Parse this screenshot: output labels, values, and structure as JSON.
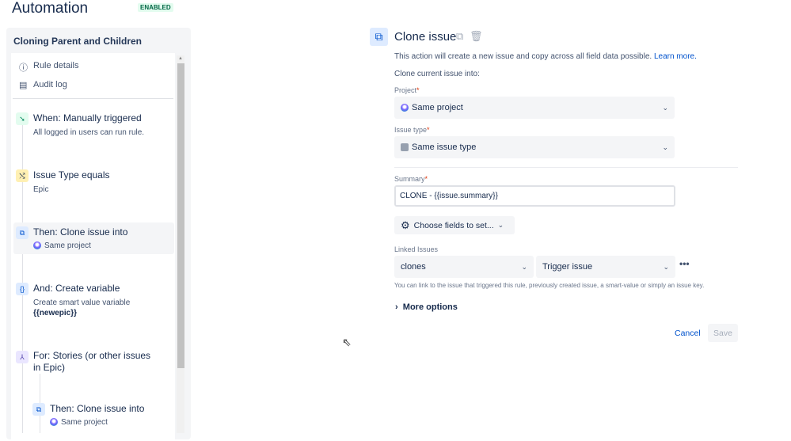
{
  "header": {
    "title": "Automation",
    "status": "ENABLED"
  },
  "sidebar": {
    "rule_name": "Cloning Parent and Children",
    "nav": [
      {
        "label": "Rule details",
        "icon": "info-icon"
      },
      {
        "label": "Audit log",
        "icon": "document-icon"
      }
    ],
    "steps": [
      {
        "title": "When: Manually triggered",
        "sub": "All logged in users can run rule.",
        "icon": "trigger-icon",
        "color": "#e3fcef"
      },
      {
        "title": "Issue Type equals",
        "sub": "Epic",
        "icon": "shuffle-icon",
        "color": "#fff0b3"
      },
      {
        "title": "Then: Clone issue into",
        "sub": "Same project",
        "icon": "clone-icon",
        "color": "#deebff"
      },
      {
        "title": "And: Create variable",
        "sub": "Create smart value variable",
        "sub2": "{{newepic}}",
        "icon": "braces-icon",
        "color": "#deebff"
      },
      {
        "title": "For: Stories (or other issues in Epic)",
        "icon": "hierarchy-icon",
        "color": "#eae6ff"
      },
      {
        "title": "Then: Clone issue into",
        "sub": "Same project",
        "icon": "clone-icon",
        "color": "#deebff"
      }
    ]
  },
  "main": {
    "title": "Clone issue",
    "description": "This action will create a new issue and copy across all field data possible.",
    "learn_more": "Learn more.",
    "clone_into": "Clone current issue into:",
    "project_label": "Project",
    "project_value": "Same project",
    "issue_type_label": "Issue type",
    "issue_type_value": "Same issue type",
    "summary_label": "Summary",
    "summary_value": "CLONE - {{issue.summary}}",
    "choose_fields": "Choose fields to set...",
    "linked_label": "Linked Issues",
    "link_type": "clones",
    "link_target": "Trigger issue",
    "linked_help": "You can link to the issue that triggered this rule, previously created issue, a smart-value or simply an issue key.",
    "more_options": "More options",
    "cancel": "Cancel",
    "save": "Save"
  }
}
